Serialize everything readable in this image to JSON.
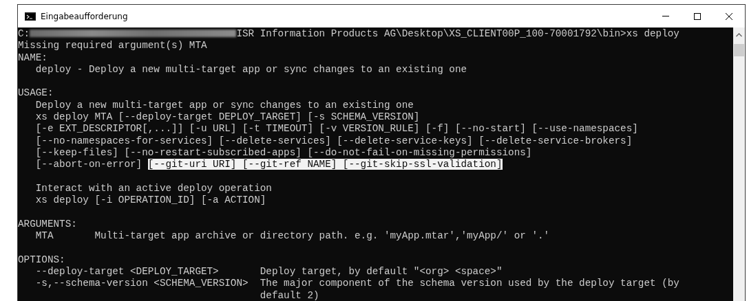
{
  "window": {
    "title": "Eingabeaufforderung"
  },
  "console": {
    "lines": [
      {
        "kind": "text",
        "segments": [
          {
            "kind": "text",
            "text": "C:",
            "selected": false
          },
          {
            "kind": "redaction"
          },
          {
            "kind": "text",
            "text": "ISR Information Products AG\\Desktop\\XS_CLIENT00P_100-70001792\\bin>xs deploy",
            "selected": false
          }
        ]
      },
      {
        "kind": "text",
        "segments": [
          {
            "kind": "text",
            "text": "Missing required argument(s) MTA",
            "selected": false
          }
        ]
      },
      {
        "kind": "text",
        "segments": [
          {
            "kind": "text",
            "text": "NAME:",
            "selected": false
          }
        ]
      },
      {
        "kind": "text",
        "segments": [
          {
            "kind": "text",
            "text": "   deploy - Deploy a new multi-target app or sync changes to an existing one",
            "selected": false
          }
        ]
      },
      {
        "kind": "blank"
      },
      {
        "kind": "text",
        "segments": [
          {
            "kind": "text",
            "text": "USAGE:",
            "selected": false
          }
        ]
      },
      {
        "kind": "text",
        "segments": [
          {
            "kind": "text",
            "text": "   Deploy a new multi-target app or sync changes to an existing one",
            "selected": false
          }
        ]
      },
      {
        "kind": "text",
        "segments": [
          {
            "kind": "text",
            "text": "   xs deploy MTA [--deploy-target DEPLOY_TARGET] [-s SCHEMA_VERSION]",
            "selected": false
          }
        ]
      },
      {
        "kind": "text",
        "segments": [
          {
            "kind": "text",
            "text": "   [-e EXT_DESCRIPTOR[,...]] [-u URL] [-t TIMEOUT] [-v VERSION_RULE] [-f] [--no-start] [--use-namespaces]",
            "selected": false
          }
        ]
      },
      {
        "kind": "text",
        "segments": [
          {
            "kind": "text",
            "text": "   [--no-namespaces-for-services] [--delete-services] [--delete-service-keys] [--delete-service-brokers]",
            "selected": false
          }
        ]
      },
      {
        "kind": "text",
        "segments": [
          {
            "kind": "text",
            "text": "   [--keep-files] [--no-restart-subscribed-apps] [--do-not-fail-on-missing-permissions]",
            "selected": false
          }
        ]
      },
      {
        "kind": "text",
        "segments": [
          {
            "kind": "text",
            "text": "   [--abort-on-error] ",
            "selected": false
          },
          {
            "kind": "text",
            "text": "[--git-uri URI] [--git-ref NAME] [--git-skip-ssl-validation]",
            "selected": true
          }
        ]
      },
      {
        "kind": "blank"
      },
      {
        "kind": "text",
        "segments": [
          {
            "kind": "text",
            "text": "   Interact with an active deploy operation",
            "selected": false
          }
        ]
      },
      {
        "kind": "text",
        "segments": [
          {
            "kind": "text",
            "text": "   xs deploy [-i OPERATION_ID] [-a ACTION]",
            "selected": false
          }
        ]
      },
      {
        "kind": "blank"
      },
      {
        "kind": "text",
        "segments": [
          {
            "kind": "text",
            "text": "ARGUMENTS:",
            "selected": false
          }
        ]
      },
      {
        "kind": "text",
        "segments": [
          {
            "kind": "text",
            "text": "   MTA       Multi-target app archive or directory path. e.g. 'myApp.mtar','myApp/' or '.'",
            "selected": false
          }
        ]
      },
      {
        "kind": "blank"
      },
      {
        "kind": "text",
        "segments": [
          {
            "kind": "text",
            "text": "OPTIONS:",
            "selected": false
          }
        ]
      },
      {
        "kind": "text",
        "segments": [
          {
            "kind": "text",
            "text": "   --deploy-target <DEPLOY_TARGET>       Deploy target, by default \"<org> <space>\"",
            "selected": false
          }
        ]
      },
      {
        "kind": "text",
        "segments": [
          {
            "kind": "text",
            "text": "   -s,--schema-version <SCHEMA_VERSION>  The major component of the schema version used by the deploy target (by",
            "selected": false
          }
        ]
      },
      {
        "kind": "text",
        "segments": [
          {
            "kind": "text",
            "text": "                                         default 2)",
            "selected": false
          }
        ]
      }
    ]
  }
}
